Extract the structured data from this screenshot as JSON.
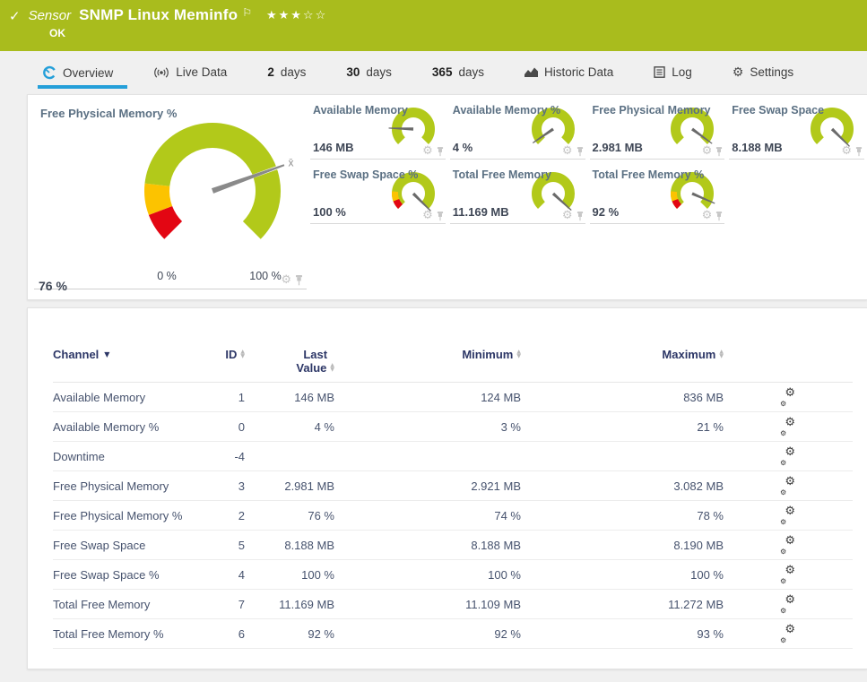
{
  "header": {
    "kind_label": "Sensor",
    "title": "SNMP Linux Meminfo",
    "status": "OK",
    "stars_filled": "★★★",
    "stars_empty": "☆☆"
  },
  "tabs": [
    {
      "label": "Overview",
      "icon": "gauge-icon",
      "active": true
    },
    {
      "label": "Live Data",
      "icon": "live-data-icon"
    },
    {
      "number": "2",
      "label": "days"
    },
    {
      "number": "30",
      "label": "days"
    },
    {
      "number": "365",
      "label": "days"
    },
    {
      "label": "Historic Data",
      "icon": "historic-data-icon"
    },
    {
      "label": "Log",
      "icon": "log-icon"
    },
    {
      "label": "Settings",
      "icon": "gear-icon"
    }
  ],
  "chart_data": {
    "type": "gauge",
    "colors": {
      "green": "#b2c91a",
      "yellow": "#fcc300",
      "red": "#e30613",
      "needle": "#8a8a8a",
      "needle_small": "#6a6a6a"
    },
    "main": {
      "title": "Free Physical Memory %",
      "value_label": "76 %",
      "value_pct": 76,
      "scale_min_label": "0 %",
      "scale_max_label": "100 %",
      "mean_marker": "x̄",
      "segments": [
        {
          "from": 0,
          "to": 9,
          "color": "red"
        },
        {
          "from": 9,
          "to": 19,
          "color": "yellow"
        },
        {
          "from": 19,
          "to": 100,
          "color": "green"
        }
      ]
    },
    "small": [
      {
        "title": "Available Memory",
        "value_label": "146 MB",
        "value_pct": 17.5,
        "warn_segments": false
      },
      {
        "title": "Available Memory %",
        "value_label": "4 %",
        "value_pct": 4,
        "warn_segments": false
      },
      {
        "title": "Free Physical Memory",
        "value_label": "2.981 MB",
        "value_pct": 96.7,
        "warn_segments": false
      },
      {
        "title": "Free Swap Space",
        "value_label": "8.188 MB",
        "value_pct": 99.9,
        "warn_segments": false
      },
      {
        "title": "Free Swap Space %",
        "value_label": "100 %",
        "value_pct": 100,
        "warn_segments": true
      },
      {
        "title": "Total Free Memory",
        "value_label": "11.169 MB",
        "value_pct": 99.1,
        "warn_segments": false
      },
      {
        "title": "Total Free Memory %",
        "value_label": "92 %",
        "value_pct": 92,
        "warn_segments": true
      }
    ]
  },
  "table": {
    "columns": [
      {
        "label": "Channel",
        "sorted": "desc"
      },
      {
        "label": "ID",
        "sort": "both"
      },
      {
        "label": "Last Value",
        "line1": "Last",
        "line2": "Value",
        "sort": "both"
      },
      {
        "label": "Minimum",
        "sort": "both"
      },
      {
        "label": "Maximum",
        "sort": "both"
      }
    ],
    "rows": [
      {
        "channel": "Available Memory",
        "id": "1",
        "last": "146 MB",
        "min": "124 MB",
        "max": "836 MB"
      },
      {
        "channel": "Available Memory %",
        "id": "0",
        "last": "4 %",
        "min": "3 %",
        "max": "21 %"
      },
      {
        "channel": "Downtime",
        "id": "-4",
        "last": "",
        "min": "",
        "max": ""
      },
      {
        "channel": "Free Physical Memory",
        "id": "3",
        "last": "2.981 MB",
        "min": "2.921 MB",
        "max": "3.082 MB"
      },
      {
        "channel": "Free Physical Memory %",
        "id": "2",
        "last": "76 %",
        "min": "74 %",
        "max": "78 %"
      },
      {
        "channel": "Free Swap Space",
        "id": "5",
        "last": "8.188 MB",
        "min": "8.188 MB",
        "max": "8.190 MB"
      },
      {
        "channel": "Free Swap Space %",
        "id": "4",
        "last": "100 %",
        "min": "100 %",
        "max": "100 %"
      },
      {
        "channel": "Total Free Memory",
        "id": "7",
        "last": "11.169 MB",
        "min": "11.109 MB",
        "max": "11.272 MB"
      },
      {
        "channel": "Total Free Memory %",
        "id": "6",
        "last": "92 %",
        "min": "92 %",
        "max": "93 %"
      }
    ]
  }
}
